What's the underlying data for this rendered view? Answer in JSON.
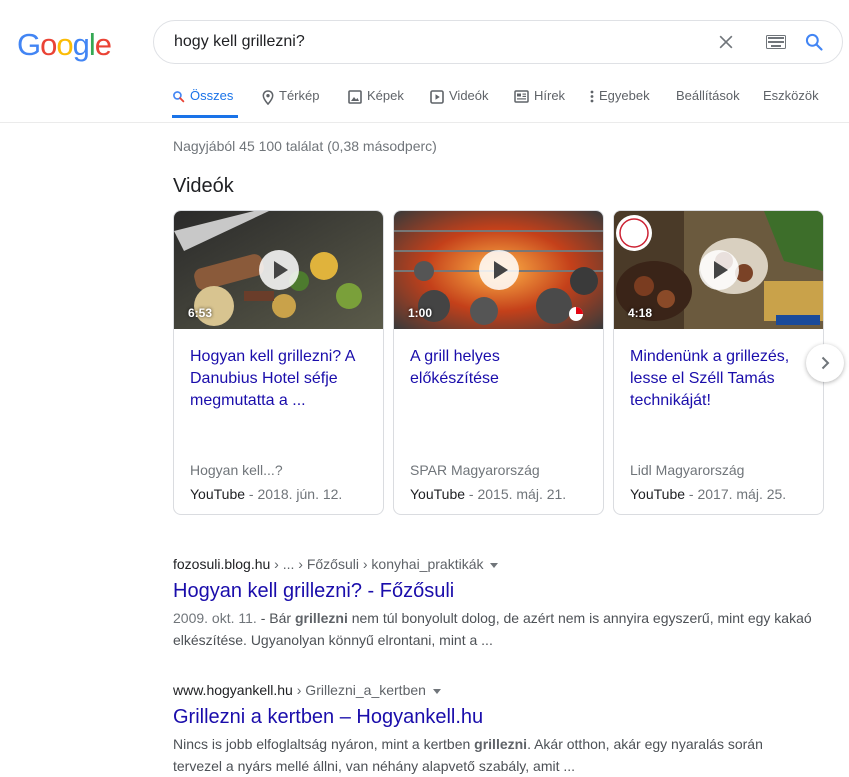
{
  "logo": {
    "letters": [
      "G",
      "o",
      "o",
      "g",
      "l",
      "e"
    ],
    "colors": [
      "#4285F4",
      "#EA4335",
      "#FBBC05",
      "#4285F4",
      "#34A853",
      "#EA4335"
    ]
  },
  "search": {
    "query": "hogy kell grillezni?"
  },
  "tabs": [
    {
      "label": "Összes",
      "icon": "search-icon",
      "active": true
    },
    {
      "label": "Térkép",
      "icon": "map-pin-icon"
    },
    {
      "label": "Képek",
      "icon": "image-icon"
    },
    {
      "label": "Videók",
      "icon": "video-icon"
    },
    {
      "label": "Hírek",
      "icon": "news-icon"
    },
    {
      "label": "Egyebek",
      "icon": "more-vert-icon"
    },
    {
      "label": "Beállítások"
    },
    {
      "label": "Eszközök"
    }
  ],
  "stats": "Nagyjából 45 100 találat (0,38 másodperc)",
  "videos": {
    "heading": "Videók",
    "items": [
      {
        "duration": "6:53",
        "title": "Hogyan kell grillezni? A Danubius Hotel séfje megmutatta a ...",
        "channel": "Hogyan kell...?",
        "source": "YouTube",
        "date": " - 2018. jún. 12."
      },
      {
        "duration": "1:00",
        "title": "A grill helyes előkészítése",
        "channel": "SPAR Magyarország",
        "source": "YouTube",
        "date": " - 2015. máj. 21."
      },
      {
        "duration": "4:18",
        "title": "Mindenünk a grillezés, lesse el Széll Tamás technikáját!",
        "channel": "Lidl Magyarország",
        "source": "YouTube",
        "date": " - 2017. máj. 25."
      }
    ]
  },
  "results": [
    {
      "domain": "fozosuli.blog.hu",
      "path": " › ... › Főzősuli › konyhai_praktikák",
      "title": "Hogyan kell grillezni? - Főzősuli",
      "date": "2009. okt. 11.",
      "snippet_a": " - Bár ",
      "bold": "grillezni",
      "snippet_b": " nem túl bonyolult dolog, de azért nem is annyira egyszerű, mint egy kakaó elkészítése. Ugyanolyan könnyű elrontani, mint a ..."
    },
    {
      "domain": "www.hogyankell.hu",
      "path": " › Grillezni_a_kertben",
      "title": "Grillezni a kertben – Hogyankell.hu",
      "date": "",
      "snippet_a": "Nincs is jobb elfoglaltság nyáron, mint a kertben ",
      "bold": "grillezni",
      "snippet_b": ". Akár otthon, akár egy nyaralás során tervezel a nyárs mellé állni, van néhány alapvető szabály, amit ..."
    }
  ]
}
